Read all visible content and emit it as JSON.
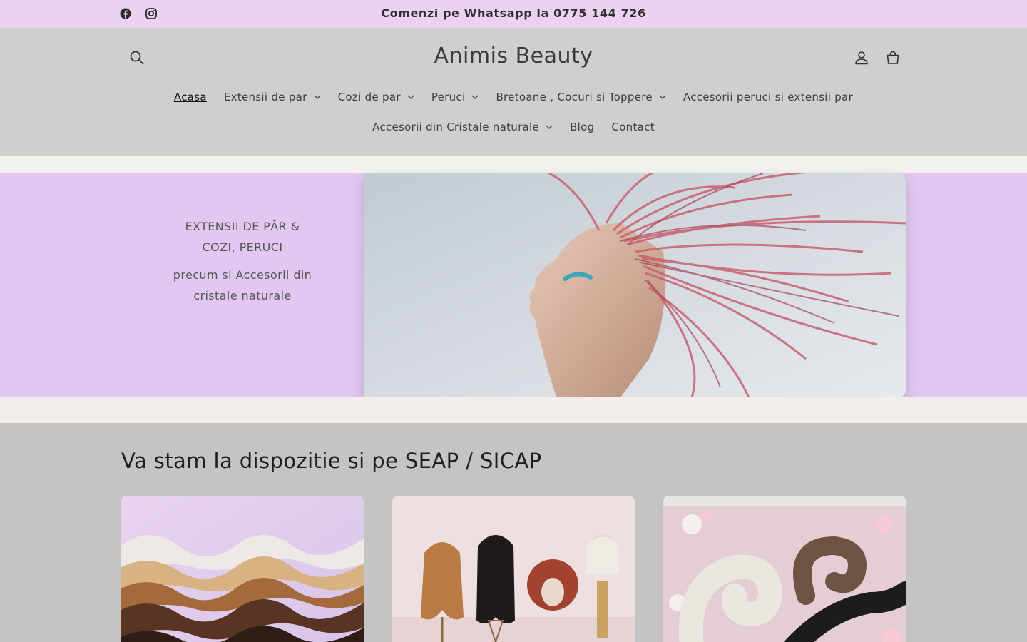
{
  "announcement": {
    "text": "Comenzi pe Whatsapp la 0775 144 726"
  },
  "social": [
    {
      "icon": "facebook-icon"
    },
    {
      "icon": "instagram-icon"
    }
  ],
  "header": {
    "logo": "Animis Beauty",
    "icons": {
      "search": "search-icon",
      "account": "account-icon",
      "cart": "cart-icon"
    }
  },
  "nav": {
    "row1": [
      {
        "label": "Acasa",
        "active": true,
        "dropdown": false
      },
      {
        "label": "Extensii de par",
        "dropdown": true
      },
      {
        "label": "Cozi de par",
        "dropdown": true
      },
      {
        "label": "Peruci",
        "dropdown": true
      },
      {
        "label": "Bretoane , Cocuri si Toppere",
        "dropdown": true
      },
      {
        "label": "Accesorii peruci si extensii par",
        "dropdown": false
      }
    ],
    "row2": [
      {
        "label": "Accesorii din Cristale naturale",
        "dropdown": true
      },
      {
        "label": "Blog",
        "dropdown": false
      },
      {
        "label": "Contact",
        "dropdown": false
      }
    ]
  },
  "hero": {
    "title_line1": "EXTENSII DE PĂR &",
    "title_line2": "COZI,  PERUCI",
    "sub_line1": "precum si Accesorii din",
    "sub_line2": "cristale naturale"
  },
  "section": {
    "title": "Va stam la dispozitie si pe SEAP / SICAP"
  },
  "colors": {
    "announce_bg": "#ead2f0",
    "header_bg": "#cfcfcf",
    "hero_bg": "#e2c8f0",
    "section_bg": "#c4c4c4"
  }
}
